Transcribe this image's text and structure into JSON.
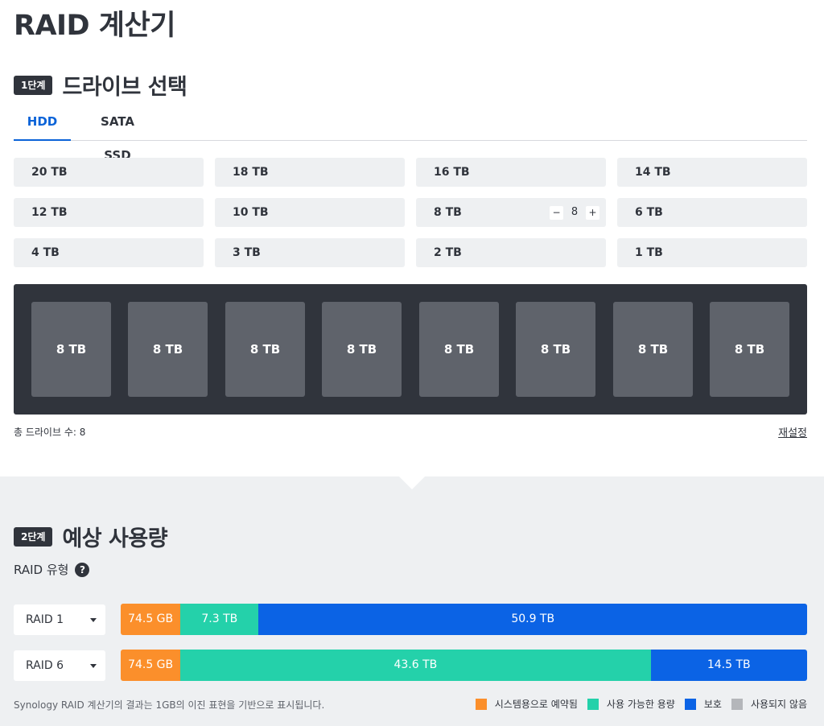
{
  "page": {
    "title": "RAID 계산기"
  },
  "step1": {
    "badge": "1단계",
    "title": "드라이브 선택"
  },
  "tabs": [
    {
      "label": "HDD",
      "active": true
    },
    {
      "label": "SATA SSD",
      "active": false
    }
  ],
  "drive_options": [
    {
      "label": "20 TB"
    },
    {
      "label": "18 TB"
    },
    {
      "label": "16 TB"
    },
    {
      "label": "14 TB"
    },
    {
      "label": "12 TB"
    },
    {
      "label": "10 TB"
    },
    {
      "label": "8 TB",
      "count": "8"
    },
    {
      "label": "6 TB"
    },
    {
      "label": "4 TB"
    },
    {
      "label": "3 TB"
    },
    {
      "label": "2 TB"
    },
    {
      "label": "1 TB"
    }
  ],
  "stepper": {
    "minus": "−",
    "plus": "+"
  },
  "slots": [
    "8 TB",
    "8 TB",
    "8 TB",
    "8 TB",
    "8 TB",
    "8 TB",
    "8 TB",
    "8 TB"
  ],
  "summary": {
    "total_drives": "총 드라이브 수: 8",
    "reset": "재설정"
  },
  "step2": {
    "badge": "2단계",
    "title": "예상 사용량"
  },
  "raid_type": {
    "label": "RAID 유형",
    "help": "?"
  },
  "raid_rows": [
    {
      "raid": "RAID 1",
      "segments": [
        {
          "kind": "sys",
          "label": "74.5 GB",
          "share": 8.7
        },
        {
          "kind": "usable",
          "label": "7.3 TB",
          "share": 11.4
        },
        {
          "kind": "protect",
          "label": "50.9 TB",
          "share": 79.9
        }
      ]
    },
    {
      "raid": "RAID 6",
      "segments": [
        {
          "kind": "sys",
          "label": "74.5 GB",
          "share": 8.7
        },
        {
          "kind": "usable",
          "label": "43.6 TB",
          "share": 68.5
        },
        {
          "kind": "protect",
          "label": "14.5 TB",
          "share": 22.8
        }
      ]
    }
  ],
  "disclaimer": "Synology RAID 계산기의 결과는 1GB의 이진 표현을 기반으로 표시됩니다.",
  "legend": [
    {
      "label": "시스템용으로 예약됨",
      "color": "#fb8f2b"
    },
    {
      "label": "사용 가능한 용량",
      "color": "#24d1aa"
    },
    {
      "label": "보호",
      "color": "#0b63e5"
    },
    {
      "label": "사용되지 않음",
      "color": "#b4b6ba"
    }
  ]
}
